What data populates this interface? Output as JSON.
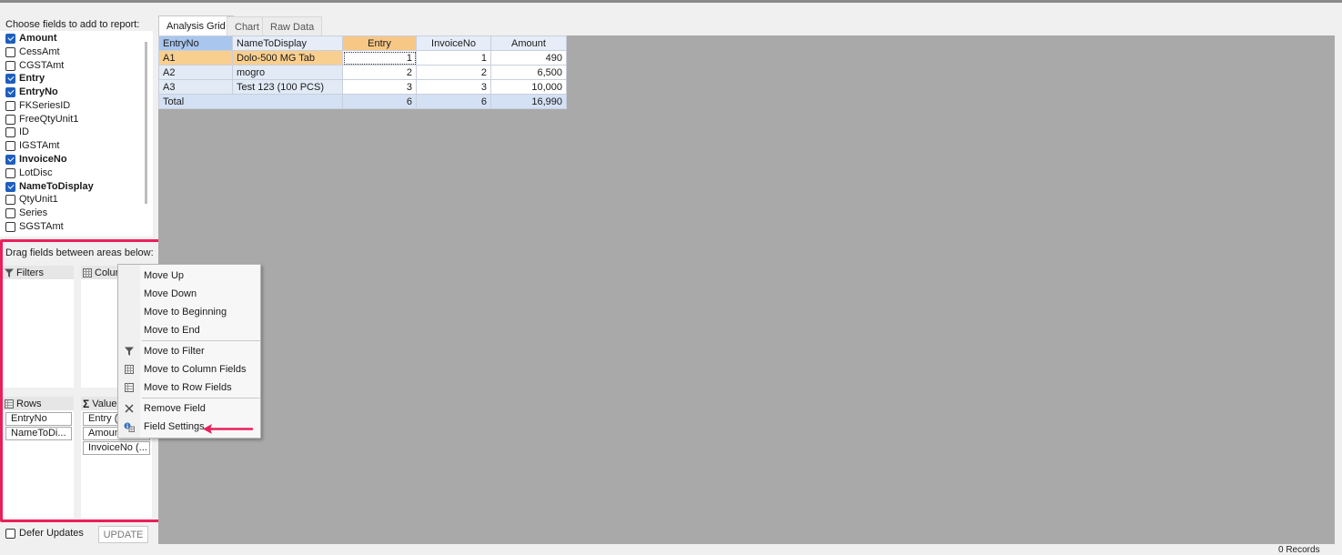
{
  "field_list": {
    "title": "Choose fields to add to report:",
    "items": [
      {
        "label": "Amount",
        "checked": true
      },
      {
        "label": "CessAmt",
        "checked": false
      },
      {
        "label": "CGSTAmt",
        "checked": false
      },
      {
        "label": "Entry",
        "checked": true
      },
      {
        "label": "EntryNo",
        "checked": true
      },
      {
        "label": "FKSeriesID",
        "checked": false
      },
      {
        "label": "FreeQtyUnit1",
        "checked": false
      },
      {
        "label": "ID",
        "checked": false
      },
      {
        "label": "IGSTAmt",
        "checked": false
      },
      {
        "label": "InvoiceNo",
        "checked": true
      },
      {
        "label": "LotDisc",
        "checked": false
      },
      {
        "label": "NameToDisplay",
        "checked": true
      },
      {
        "label": "QtyUnit1",
        "checked": false
      },
      {
        "label": "Series",
        "checked": false
      },
      {
        "label": "SGSTAmt",
        "checked": false
      }
    ]
  },
  "areas": {
    "title": "Drag fields between areas below:",
    "filters_label": "Filters",
    "columns_label": "Colum",
    "rows_label": "Rows",
    "values_label": "Value",
    "rows_fields": [
      "EntryNo",
      "NameToDi..."
    ],
    "values_fields": [
      "Entry (S",
      "Amoun",
      "InvoiceNo (..."
    ]
  },
  "defer": {
    "label": "Defer Updates",
    "update_label": "UPDATE"
  },
  "tabs": [
    "Analysis Grid",
    "Chart",
    "Raw Data"
  ],
  "grid": {
    "row_headers": [
      "EntryNo",
      "NameToDisplay"
    ],
    "columns": [
      "Entry",
      "InvoiceNo",
      "Amount"
    ],
    "rows": [
      {
        "entry_no": "A1",
        "name": "Dolo-500 MG Tab",
        "entry": "1",
        "invoice": "1",
        "amount": "490"
      },
      {
        "entry_no": "A2",
        "name": "mogro",
        "entry": "2",
        "invoice": "2",
        "amount": "6,500"
      },
      {
        "entry_no": "A3",
        "name": "Test 123 (100 PCS)",
        "entry": "3",
        "invoice": "3",
        "amount": "10,000"
      }
    ],
    "total": {
      "label": "Total",
      "entry": "6",
      "invoice": "6",
      "amount": "16,990"
    }
  },
  "context_menu": {
    "move_up": "Move Up",
    "move_down": "Move Down",
    "move_beginning": "Move to Beginning",
    "move_end": "Move to End",
    "move_filter": "Move to Filter",
    "move_column": "Move to Column Fields",
    "move_row": "Move to Row Fields",
    "remove": "Remove Field",
    "settings": "Field Settings"
  },
  "status_text": "0 Records",
  "colors": {
    "accent": "#1d5fbf",
    "highlight": "#ea1f5a",
    "selected_row": "#f8cf8f",
    "grid_background": "#a9a9a9"
  }
}
